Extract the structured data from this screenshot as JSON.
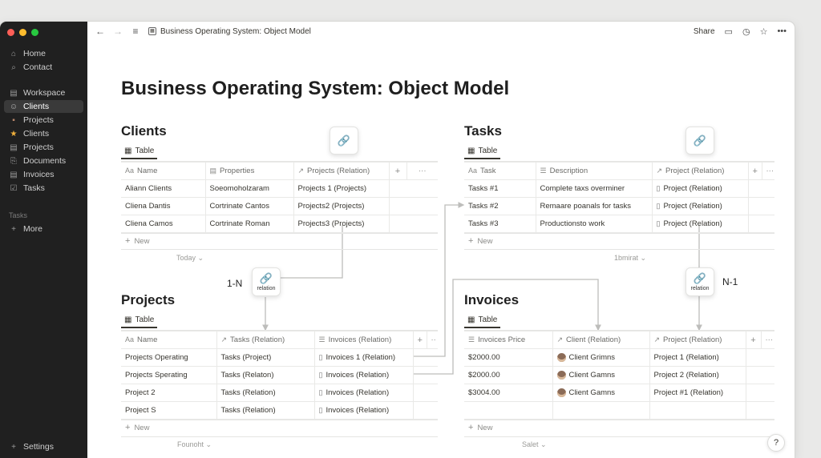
{
  "sidebar": {
    "items": [
      {
        "icon": "home-icon",
        "glyph": "⌂",
        "label": "Home",
        "active": false
      },
      {
        "icon": "search-icon",
        "glyph": "⌕",
        "label": "Contact",
        "active": false
      },
      {
        "icon": "workspace-icon",
        "glyph": "▤",
        "label": "Workspace",
        "active": false
      },
      {
        "icon": "people-icon",
        "glyph": "👥",
        "label": "Clients",
        "active": true
      },
      {
        "icon": "briefcase-icon",
        "glyph": "▪",
        "label": "Projects",
        "active": false
      },
      {
        "icon": "star-icon",
        "glyph": "★",
        "label": "Clients",
        "active": false
      },
      {
        "icon": "folder-icon",
        "glyph": "▤",
        "label": "Projects",
        "active": false
      },
      {
        "icon": "document-icon",
        "glyph": "⎘",
        "label": "Documents",
        "active": false
      },
      {
        "icon": "invoice-icon",
        "glyph": "▤",
        "label": "Invoices",
        "active": false
      },
      {
        "icon": "task-icon",
        "glyph": "☑",
        "label": "Tasks",
        "active": false
      }
    ],
    "section_heading": "Tasks",
    "more_label": "More",
    "settings_label": "Settings"
  },
  "topbar": {
    "breadcrumb": "Business Operating System: Object Model",
    "share_label": "Share"
  },
  "page": {
    "title": "Business Operating System: Object Model"
  },
  "databases": {
    "clients": {
      "title": "Clients",
      "tab": "Table",
      "headers": [
        "Name",
        "Properties",
        "Projects (Relation)"
      ],
      "rows": [
        [
          "Aliann Clients",
          "Soeomoholzaram",
          "Projects 1 (Projects)"
        ],
        [
          "Cliena Dantis",
          "Cortrinate Cantos",
          "Projects2 (Projects)"
        ],
        [
          "Cliena Camos",
          "Cortrinate Roman",
          "Projects3 (Projects)"
        ]
      ],
      "new_label": "New",
      "footer": "Today"
    },
    "tasks": {
      "title": "Tasks",
      "tab": "Table",
      "headers": [
        "Task",
        "Description",
        "Project (Relation)"
      ],
      "rows": [
        [
          "Tasks #1",
          "Complete taxs overminer",
          "Project (Relation)"
        ],
        [
          "Tasks #2",
          "Remaare poanals for tasks",
          "Project (Relation)"
        ],
        [
          "Tasks #3",
          "Productionsto work",
          "Project (Relation)"
        ]
      ],
      "new_label": "New",
      "footer": "1bmirat"
    },
    "projects": {
      "title": "Projects",
      "tab": "Table",
      "headers": [
        "Name",
        "Tasks (Relation)",
        "Invoices (Relation)"
      ],
      "rows": [
        [
          "Projects Operating",
          "Tasks (Project)",
          "Invoices 1 (Relation)"
        ],
        [
          "Projects Sperating",
          "Tasks (Relaton)",
          "Invoices (Relation)"
        ],
        [
          "Project 2",
          "Tasks (Relation)",
          "Invoices (Relation)"
        ],
        [
          "Project S",
          "Tasks (Relation)",
          "Invoices (Relation)"
        ]
      ],
      "new_label": "New",
      "footer": "Founoht"
    },
    "invoices": {
      "title": "Invoices",
      "tab": "Table",
      "headers": [
        "Invoices Price",
        "Client (Relation)",
        "Project (Relation)"
      ],
      "rows": [
        [
          "$2000.00",
          "Client Grimns",
          "Project 1 (Relation)"
        ],
        [
          "$2000.00",
          "Client Gamns",
          "Project 2 (Relation)"
        ],
        [
          "$3004.00",
          "Client Gamns",
          "Project #1 (Relation)"
        ],
        [
          "",
          "",
          ""
        ]
      ],
      "new_label": "New",
      "footer": "Salet"
    }
  },
  "relations": {
    "clients_projects": {
      "cardinality": "1-N",
      "label": "relation"
    },
    "tasks_invoices": {
      "cardinality": "N-1",
      "label": "relation"
    }
  },
  "help_label": "?"
}
